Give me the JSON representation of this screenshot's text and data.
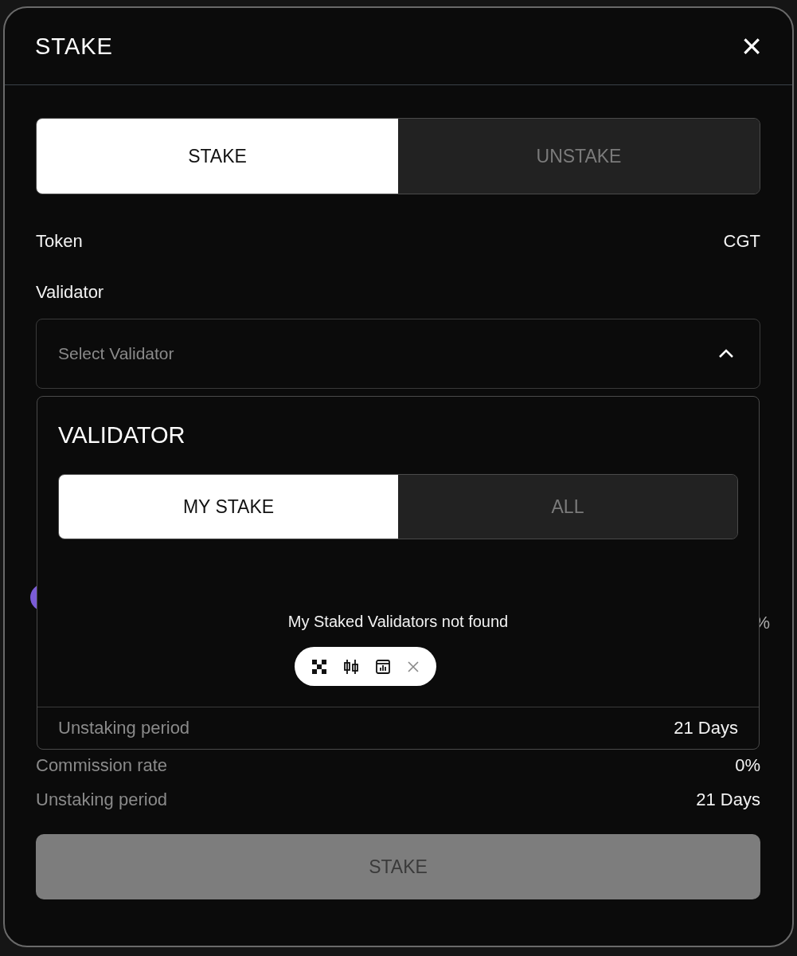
{
  "modal": {
    "title": "STAKE",
    "close": "×"
  },
  "mode_tabs": [
    {
      "label": "STAKE",
      "selected": true
    },
    {
      "label": "UNSTAKE",
      "selected": false
    }
  ],
  "token": {
    "label": "Token",
    "value": "CGT"
  },
  "validator": {
    "label": "Validator",
    "placeholder": "Select Validator",
    "expanded": true
  },
  "hidden_row": {
    "value": "%"
  },
  "dropdown": {
    "title": "VALIDATOR",
    "tabs": [
      {
        "label": "MY STAKE",
        "selected": true
      },
      {
        "label": "ALL",
        "selected": false
      }
    ],
    "empty_message": "My Staked Validators not found",
    "footer": {
      "label": "Unstaking period",
      "value": "21 Days"
    }
  },
  "details": [
    {
      "label": "Commission rate",
      "value": "0%"
    },
    {
      "label": "Unstaking period",
      "value": "21 Days"
    }
  ],
  "submit": {
    "label": "STAKE",
    "disabled": true
  }
}
